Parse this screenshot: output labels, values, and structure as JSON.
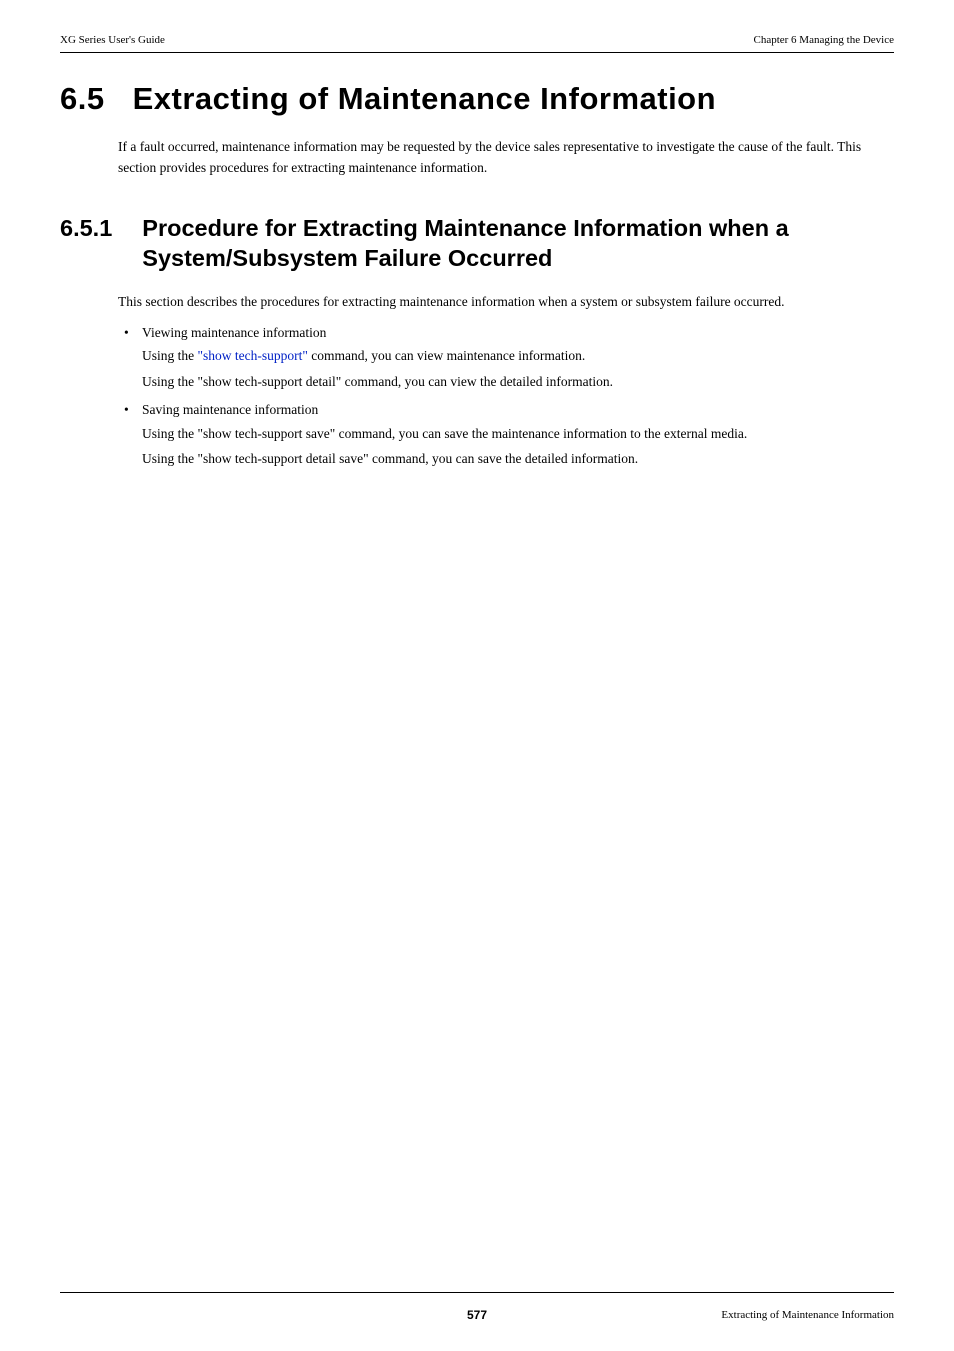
{
  "header": {
    "left": "XG Series User's Guide",
    "right": "Chapter 6 Managing the Device"
  },
  "h1": {
    "number": "6.5",
    "title": "Extracting of Maintenance Information"
  },
  "intro": "If a fault occurred, maintenance information may be requested by the device sales representative to investigate the cause of the fault. This section provides procedures for extracting maintenance information.",
  "h2": {
    "number": "6.5.1",
    "title": "Procedure for Extracting Maintenance Information when a System/Subsystem Failure Occurred"
  },
  "body": {
    "lead": "This section describes the procedures for extracting maintenance information when a system or subsystem failure occurred.",
    "items": [
      {
        "title": "Viewing maintenance information",
        "line1_pre": "Using the ",
        "line1_link": "\"show tech-support\"",
        "line1_post": " command, you can view maintenance information.",
        "line2": "Using the \"show tech-support detail\" command, you can view the detailed information."
      },
      {
        "title": "Saving maintenance information",
        "line1_plain": "Using the \"show tech-support save\" command, you can save the maintenance information to the external media.",
        "line2": "Using the \"show tech-support detail save\" command, you can save the detailed information."
      }
    ]
  },
  "footer": {
    "page": "577",
    "right": "Extracting of Maintenance Information"
  }
}
